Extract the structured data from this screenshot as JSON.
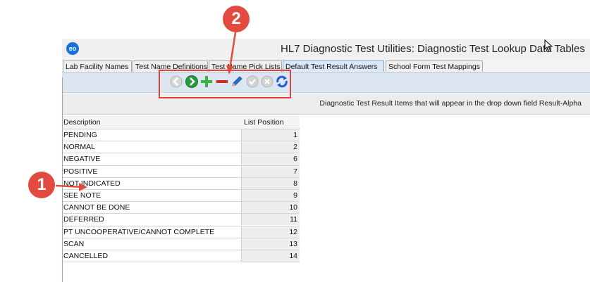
{
  "window": {
    "app_icon": "eo",
    "title": "HL7 Diagnostic Test Utilities:  Diagnostic Test Lookup Data Tables"
  },
  "tabs": [
    {
      "label": "Lab Facility Names",
      "active": false
    },
    {
      "label": "Test Name Definitions",
      "active": false
    },
    {
      "label": "Test Name Pick Lists",
      "active": false
    },
    {
      "label": "Default Test Result Answers",
      "active": true
    },
    {
      "label": "School Form Test Mappings",
      "active": false
    }
  ],
  "toolbar": {
    "buttons": [
      {
        "icon": "back-arrow-icon",
        "enabled": false
      },
      {
        "icon": "forward-arrow-icon",
        "enabled": true
      },
      {
        "icon": "add-plus-icon",
        "enabled": true
      },
      {
        "icon": "remove-minus-icon",
        "enabled": true
      },
      {
        "icon": "edit-pencil-icon",
        "enabled": true
      },
      {
        "icon": "save-check-icon",
        "enabled": false
      },
      {
        "icon": "cancel-x-icon",
        "enabled": false
      },
      {
        "icon": "refresh-icon",
        "enabled": true
      }
    ]
  },
  "subheader": "Diagnostic Test Result Items that will appear in the drop down field Result-Alpha",
  "table": {
    "columns": [
      "Description",
      "List Position"
    ],
    "rows": [
      {
        "description": "PENDING",
        "position": "1"
      },
      {
        "description": "NORMAL",
        "position": "2"
      },
      {
        "description": "NEGATIVE",
        "position": "6"
      },
      {
        "description": "POSITIVE",
        "position": "7"
      },
      {
        "description": "NOT INDICATED",
        "position": "8"
      },
      {
        "description": "SEE NOTE",
        "position": "9"
      },
      {
        "description": "CANNOT BE DONE",
        "position": "10"
      },
      {
        "description": "DEFERRED",
        "position": "11"
      },
      {
        "description": "PT UNCOOPERATIVE/CANNOT COMPLETE",
        "position": "12"
      },
      {
        "description": "SCAN",
        "position": "13"
      },
      {
        "description": "CANCELLED",
        "position": "14"
      }
    ]
  },
  "annotations": {
    "callout_1": "1",
    "callout_2": "2",
    "color": "#e24b3f"
  }
}
